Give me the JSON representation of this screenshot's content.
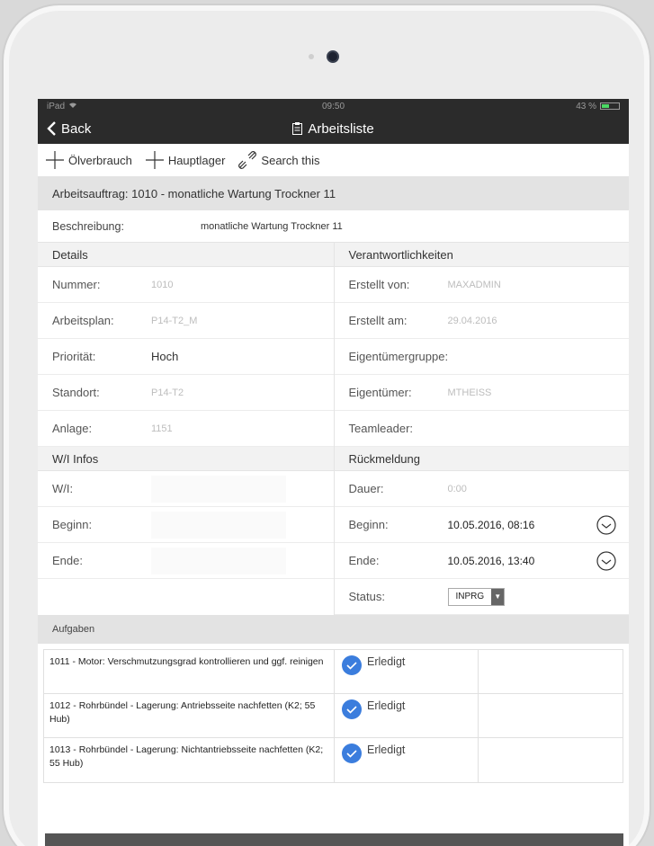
{
  "statusbar": {
    "device": "iPad",
    "time": "09:50",
    "battery": "43 %",
    "battery_fill": 0.43
  },
  "navbar": {
    "back_label": "Back",
    "title": "Arbeitsliste"
  },
  "toolbar": {
    "oil_label": "Ölverbrauch",
    "store_label": "Hauptlager",
    "search_label": "Search this"
  },
  "work_order": {
    "header": "Arbeitsauftrag: 1010 - monatliche Wartung Trockner 11",
    "desc_label": "Beschreibung:",
    "desc_value": "monatliche Wartung Trockner 11"
  },
  "details": {
    "title": "Details",
    "rows": [
      {
        "label": "Nummer:",
        "value": "1010"
      },
      {
        "label": "Arbeitsplan:",
        "value": "P14-T2_M"
      },
      {
        "label": "Priorität:",
        "value": "Hoch"
      },
      {
        "label": "Standort:",
        "value": "P14-T2"
      },
      {
        "label": "Anlage:",
        "value": "1151"
      }
    ]
  },
  "responsibilities": {
    "title": "Verantwortlichkeiten",
    "rows": [
      {
        "label": "Erstellt von:",
        "value": "MAXADMIN"
      },
      {
        "label": "Erstellt am:",
        "value": "29.04.2016"
      },
      {
        "label": "Eigentümergruppe:",
        "value": ""
      },
      {
        "label": "Eigentümer:",
        "value": "MTHEISS"
      },
      {
        "label": "Teamleader:",
        "value": ""
      }
    ]
  },
  "wi_infos": {
    "title": "W/I Infos",
    "rows": [
      {
        "label": "W/I:"
      },
      {
        "label": "Beginn:"
      },
      {
        "label": "Ende:"
      }
    ]
  },
  "feedback": {
    "title": "Rückmeldung",
    "duration_label": "Dauer:",
    "duration_value": "0:00",
    "begin_label": "Beginn:",
    "begin_value": "10.05.2016, 08:16",
    "end_label": "Ende:",
    "end_value": "10.05.2016, 13:40",
    "status_label": "Status:",
    "status_value": "INPRG"
  },
  "tasks": {
    "title": "Aufgaben",
    "items": [
      {
        "text": "1011 - Motor: Verschmutzungsgrad kontrollieren und ggf. reinigen",
        "status": "Erledigt"
      },
      {
        "text": "1012 - Rohrbündel - Lagerung: Antriebsseite nachfetten (K2; 55 Hub)",
        "status": "Erledigt"
      },
      {
        "text": "1013 - Rohrbündel - Lagerung: Nichtantriebsseite nachfetten (K2; 55 Hub)",
        "status": "Erledigt"
      }
    ]
  },
  "colors": {
    "navbar": "#2b2b2b",
    "accent": "#3b7ddd",
    "band": "#e3e3e3",
    "battery": "#4cd964"
  },
  "icons": [
    "wifi-icon",
    "chevron-left-icon",
    "clipboard-icon",
    "plus-icon",
    "link-icon",
    "clock-icon",
    "check-circle-icon"
  ]
}
